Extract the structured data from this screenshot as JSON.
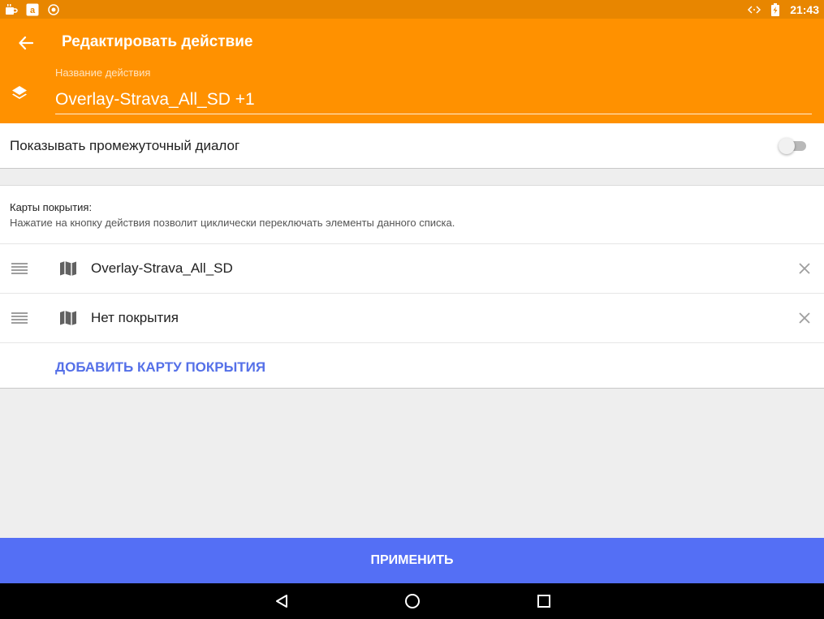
{
  "status_bar": {
    "time": "21:43",
    "left_icons": [
      "coffee-icon",
      "amazon-icon",
      "shield-icon"
    ],
    "right_icons": [
      "code-icon",
      "battery-charging-icon"
    ]
  },
  "app_bar": {
    "title": "Редактировать действие",
    "name_label": "Название действия",
    "name_value": "Overlay-Strava_All_SD +1",
    "color": "#ff9100"
  },
  "toggle": {
    "label": "Показывать промежуточный диалог",
    "checked": false
  },
  "coverage": {
    "title": "Карты покрытия:",
    "description": "Нажатие на кнопку действия позволит циклически переключать элементы данного списка.",
    "items": [
      {
        "label": "Overlay-Strava_All_SD"
      },
      {
        "label": "Нет покрытия"
      }
    ],
    "add_label": "ДОБАВИТЬ КАРТУ ПОКРЫТИЯ"
  },
  "apply_label": "ПРИМЕНИТЬ",
  "colors": {
    "accent": "#546ff5",
    "status_bar": "#e88600"
  }
}
